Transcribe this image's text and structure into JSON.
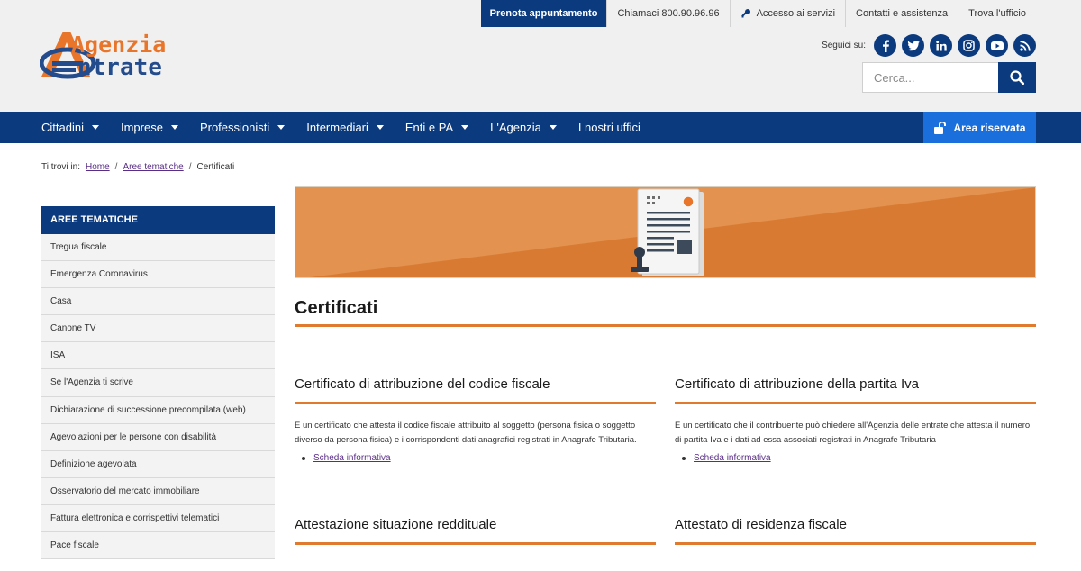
{
  "logo": {
    "line1": "Agenzia",
    "line2": "ntrate"
  },
  "topnav": {
    "primary": "Prenota appuntamento",
    "phone": "Chiamaci 800.90.96.96",
    "access": "Accesso ai servizi",
    "contacts": "Contatti e assistenza",
    "office": "Trova l'ufficio"
  },
  "social": {
    "label": "Seguici su:",
    "icons": [
      "facebook-icon",
      "twitter-icon",
      "linkedin-icon",
      "instagram-icon",
      "youtube-icon",
      "rss-icon"
    ]
  },
  "search": {
    "placeholder": "Cerca..."
  },
  "mainnav": {
    "items": [
      {
        "label": "Cittadini",
        "has_caret": true
      },
      {
        "label": "Imprese",
        "has_caret": true
      },
      {
        "label": "Professionisti",
        "has_caret": true
      },
      {
        "label": "Intermediari",
        "has_caret": true
      },
      {
        "label": "Enti e PA",
        "has_caret": true
      },
      {
        "label": "L'Agenzia",
        "has_caret": true
      },
      {
        "label": "I nostri uffici",
        "has_caret": false
      }
    ],
    "area_riservata": "Area riservata"
  },
  "breadcrumb": {
    "prefix": "Ti trovi in:",
    "items": [
      "Home",
      "Aree tematiche",
      "Certificati"
    ],
    "separator": "/"
  },
  "sidebar": {
    "title": "AREE TEMATICHE",
    "items": [
      "Tregua fiscale",
      "Emergenza Coronavirus",
      "Casa",
      "Canone TV",
      "ISA",
      "Se l'Agenzia ti scrive",
      "Dichiarazione di successione precompilata (web)",
      "Agevolazioni per le persone con disabilità",
      "Definizione agevolata",
      "Osservatorio del mercato immobiliare",
      "Fattura elettronica e corrispettivi telematici",
      "Pace fiscale"
    ]
  },
  "main": {
    "title": "Certificati",
    "cards": [
      {
        "title": "Certificato di attribuzione del codice fiscale",
        "text": "È un certificato che attesta il codice fiscale attribuito al soggetto (persona fisica o soggetto diverso da persona fisica) e i corrispondenti dati anagrafici registrati in Anagrafe Tributaria.",
        "link": "Scheda informativa"
      },
      {
        "title": "Certificato di attribuzione della partita Iva",
        "text": "È un certificato che il contribuente può chiedere all'Agenzia delle entrate che attesta il numero di partita Iva e i dati ad essa associati registrati in Anagrafe Tributaria",
        "link": "Scheda informativa"
      },
      {
        "title": "Attestazione situazione reddituale"
      },
      {
        "title": "Attestato di residenza fiscale"
      }
    ]
  },
  "colors": {
    "brand_blue": "#0b3a7e",
    "accent_orange": "#e07a2e",
    "area_blue": "#1a6fdc",
    "link_purple": "#5a2e86"
  }
}
